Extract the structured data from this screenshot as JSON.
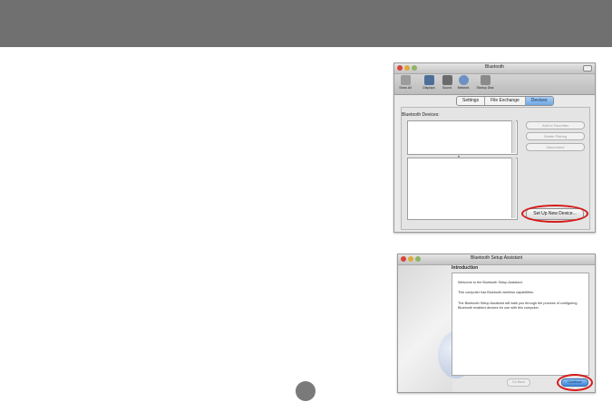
{
  "bluetooth_window": {
    "title": "Bluetooth",
    "toolbar": [
      "Show All",
      "Displays",
      "Sound",
      "Network",
      "Startup Disk"
    ],
    "tabs": [
      "Settings",
      "File Exchange",
      "Devices"
    ],
    "active_tab": "Devices",
    "devices_label": "Bluetooth Devices:",
    "buttons": {
      "add_favorites": "Add to Favorites",
      "delete_pairing": "Delete Pairing",
      "disconnect": "Disconnect",
      "setup_new_device": "Set Up New Device..."
    }
  },
  "assistant_window": {
    "title": "Bluetooth Setup Assistant",
    "section_title": "Introduction",
    "paragraphs": [
      "Welcome to the Bluetooth Setup Assistant.",
      "This computer has Bluetooth wireless capabilities.",
      "The Bluetooth Setup Assistant will walk you through the process of configuring Bluetooth enabled devices for use with this computer."
    ],
    "buttons": {
      "go_back": "Go Back",
      "continue": "Continue"
    }
  },
  "colors": {
    "header_bar": "#707070",
    "highlight_ring": "#d61a1a",
    "accent_blue": "#6ea7e3"
  }
}
